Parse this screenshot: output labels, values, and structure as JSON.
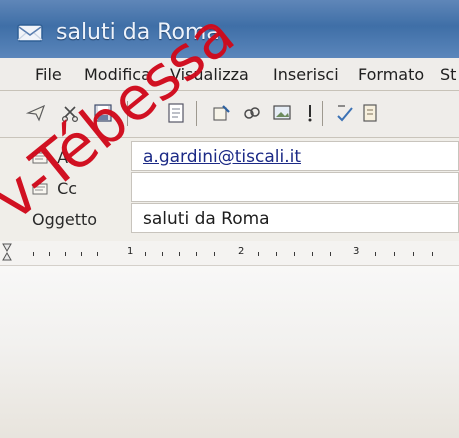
{
  "window": {
    "title": "saluti da Roma"
  },
  "menu": [
    {
      "label": "File"
    },
    {
      "label": "Modifica"
    },
    {
      "label": "Visualizza"
    },
    {
      "label": "Inserisci"
    },
    {
      "label": "Formato"
    },
    {
      "label": "St"
    }
  ],
  "toolbar": {
    "icons": [
      "send-icon",
      "cut-icon",
      "save-icon",
      "page-icon",
      "edit-icon",
      "link-icon",
      "image-icon",
      "priority-icon",
      "spellcheck-icon",
      "address-book-icon"
    ]
  },
  "headers": {
    "to_label": "A.",
    "to_value": "a.gardini@tiscali.it",
    "cc_label": "Cc",
    "cc_value": "",
    "subject_label": "Oggetto",
    "subject_value": "saluti da Roma"
  },
  "ruler": {
    "labels": [
      "1",
      "2",
      "3"
    ]
  },
  "watermark": {
    "text": "v-Tébessa"
  }
}
